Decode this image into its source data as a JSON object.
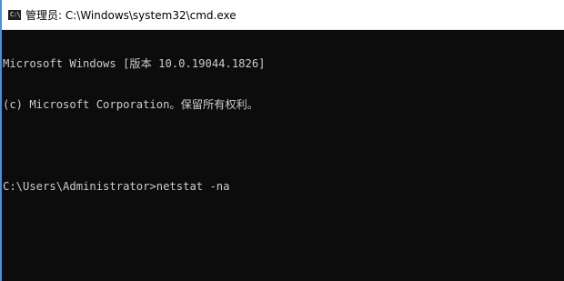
{
  "window": {
    "title": "管理员: C:\\Windows\\system32\\cmd.exe",
    "icon": "cmd-icon",
    "icon_glyph": "C:\\"
  },
  "console": {
    "lines": [
      "Microsoft Windows [版本 10.0.19044.1826]",
      "(c) Microsoft Corporation。保留所有权利。",
      "",
      "C:\\Users\\Administrator>netstat -na"
    ]
  },
  "colors": {
    "console_background": "#0c0c0c",
    "console_text": "#cccccc",
    "titlebar_background": "#ffffff",
    "window_accent": "#4a90d9"
  }
}
